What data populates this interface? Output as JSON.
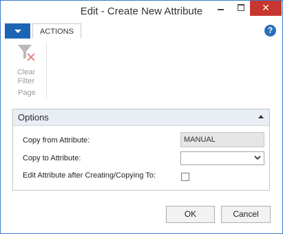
{
  "window": {
    "title": "Edit - Create New Attribute",
    "close_symbol": "✕"
  },
  "ribbon": {
    "tab_label": "ACTIONS",
    "help_symbol": "?",
    "clear_filter_line1": "Clear",
    "clear_filter_line2": "Filter",
    "group_label": "Page"
  },
  "options": {
    "title": "Options",
    "copy_from_label": "Copy from Attribute:",
    "copy_from_value": "MANUAL",
    "copy_to_label": "Copy to Attribute:",
    "copy_to_value": "",
    "edit_after_label": "Edit Attribute after Creating/Copying To:",
    "edit_after_checked": false
  },
  "buttons": {
    "ok_label": "OK",
    "cancel_label": "Cancel"
  },
  "colors": {
    "accent": "#1e64b4",
    "close_red": "#c7372f",
    "panel_header": "#e9eef5"
  }
}
